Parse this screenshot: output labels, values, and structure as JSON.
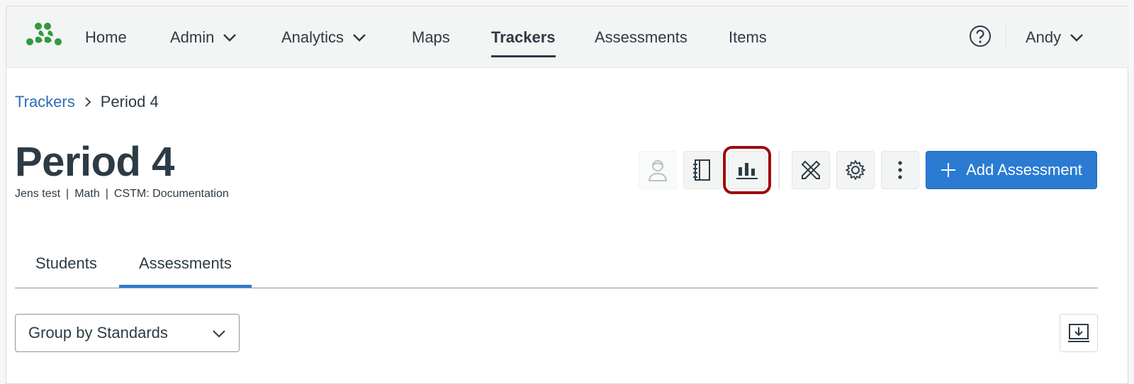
{
  "nav": {
    "items": [
      {
        "label": "Home",
        "has_dropdown": false
      },
      {
        "label": "Admin",
        "has_dropdown": true
      },
      {
        "label": "Analytics",
        "has_dropdown": true
      },
      {
        "label": "Maps",
        "has_dropdown": false
      },
      {
        "label": "Trackers",
        "has_dropdown": false,
        "active": true
      },
      {
        "label": "Assessments",
        "has_dropdown": false
      },
      {
        "label": "Items",
        "has_dropdown": false
      }
    ],
    "user": "Andy",
    "logo_color": "#2f9a3f"
  },
  "breadcrumb": {
    "parent": "Trackers",
    "current": "Period 4"
  },
  "page": {
    "title": "Period 4",
    "meta": [
      "Jens test",
      "Math",
      "CSTM: Documentation"
    ]
  },
  "toolbar": {
    "buttons": [
      "student-icon",
      "notebook-icon",
      "bar-chart-icon",
      "tools-icon",
      "gear-icon",
      "more-vertical-icon"
    ],
    "highlighted": "bar-chart-icon",
    "add_label": "Add Assessment",
    "accent_color": "#2b7bd3",
    "highlight_color": "#9e0b0f"
  },
  "tabs": {
    "items": [
      "Students",
      "Assessments"
    ],
    "active": "Assessments"
  },
  "filter": {
    "group_by": "Group by Standards"
  }
}
